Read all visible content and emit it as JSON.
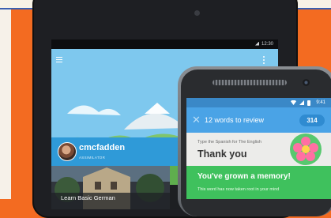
{
  "tablet": {
    "status_time": "12:30",
    "user": {
      "username": "cmcfadden",
      "rank": "ASSIMILATOR"
    },
    "course": {
      "title": "Learn Basic German"
    }
  },
  "phone": {
    "status_time": "9:41",
    "review": {
      "title": "12 words to review",
      "count": "314"
    },
    "card": {
      "prompt": "Type the Spanish for The English",
      "word": "Thank you"
    },
    "banner": {
      "title": "You've grown a memory!",
      "text": "This word has now taken root in your mind"
    }
  },
  "icons": [
    "menu-icon",
    "more-icon",
    "wifi-icon",
    "signal-icon",
    "battery-icon",
    "close-icon",
    "flower-icon"
  ],
  "colors": {
    "background": "#f36b21",
    "sky": "#7ec8ee",
    "profile_bar": "#2f9ad8",
    "toolbar": "#4aa3e6",
    "success": "#3fc15d"
  }
}
